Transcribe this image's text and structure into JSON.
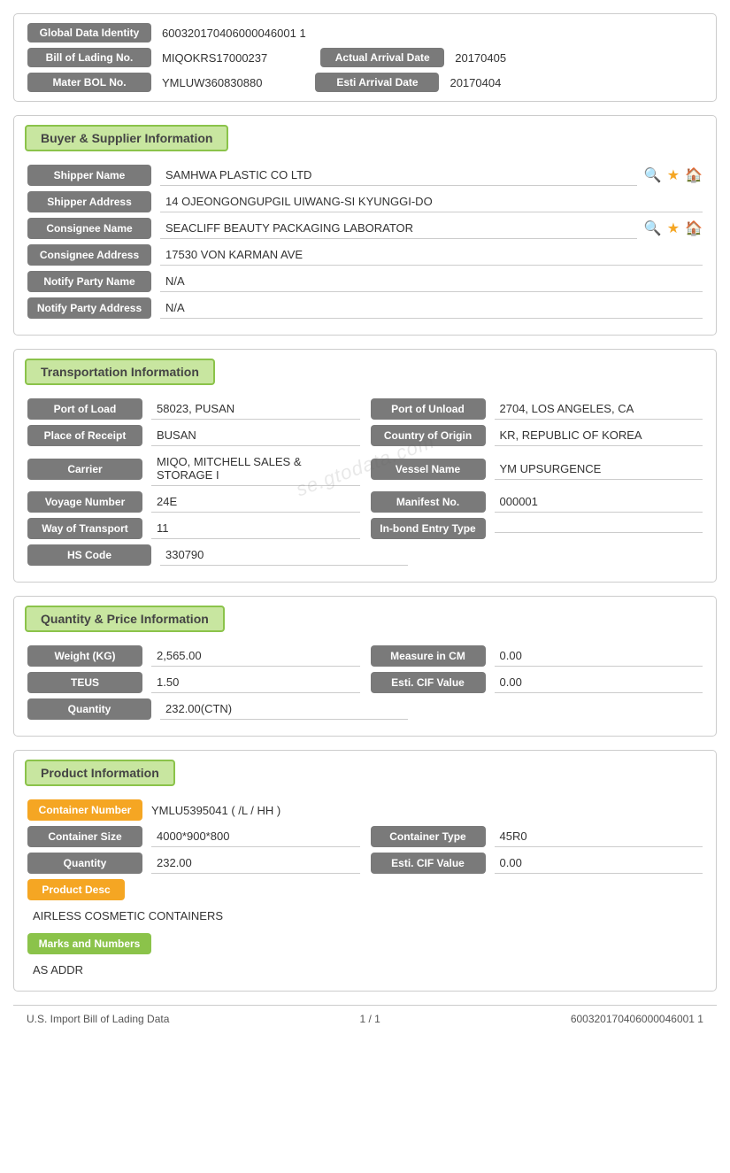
{
  "identity": {
    "global_label": "Global Data Identity",
    "global_value": "600320170406000046001 1",
    "bol_label": "Bill of Lading No.",
    "bol_value": "MIQOKRS17000237",
    "actual_arrival_label": "Actual Arrival Date",
    "actual_arrival_value": "20170405",
    "master_bol_label": "Mater BOL No.",
    "master_bol_value": "YMLUW360830880",
    "esti_arrival_label": "Esti Arrival Date",
    "esti_arrival_value": "20170404"
  },
  "buyer_supplier": {
    "header": "Buyer & Supplier Information",
    "shipper_name_label": "Shipper Name",
    "shipper_name_value": "SAMHWA PLASTIC CO LTD",
    "shipper_address_label": "Shipper Address",
    "shipper_address_value": "14 OJEONGONGUPGIL UIWANG-SI KYUNGGI-DO",
    "consignee_name_label": "Consignee Name",
    "consignee_name_value": "SEACLIFF BEAUTY PACKAGING LABORATOR",
    "consignee_address_label": "Consignee Address",
    "consignee_address_value": "17530 VON KARMAN AVE",
    "notify_party_name_label": "Notify Party Name",
    "notify_party_name_value": "N/A",
    "notify_party_address_label": "Notify Party Address",
    "notify_party_address_value": "N/A"
  },
  "transportation": {
    "header": "Transportation Information",
    "port_load_label": "Port of Load",
    "port_load_value": "58023, PUSAN",
    "port_unload_label": "Port of Unload",
    "port_unload_value": "2704, LOS ANGELES, CA",
    "place_receipt_label": "Place of Receipt",
    "place_receipt_value": "BUSAN",
    "country_origin_label": "Country of Origin",
    "country_origin_value": "KR, REPUBLIC OF KOREA",
    "carrier_label": "Carrier",
    "carrier_value": "MIQO, MITCHELL SALES & STORAGE I",
    "vessel_name_label": "Vessel Name",
    "vessel_name_value": "YM UPSURGENCE",
    "voyage_number_label": "Voyage Number",
    "voyage_number_value": "24E",
    "manifest_no_label": "Manifest No.",
    "manifest_no_value": "000001",
    "way_transport_label": "Way of Transport",
    "way_transport_value": "11",
    "inbond_entry_label": "In-bond Entry Type",
    "inbond_entry_value": "",
    "hs_code_label": "HS Code",
    "hs_code_value": "330790"
  },
  "quantity_price": {
    "header": "Quantity & Price Information",
    "weight_label": "Weight (KG)",
    "weight_value": "2,565.00",
    "measure_label": "Measure in CM",
    "measure_value": "0.00",
    "teus_label": "TEUS",
    "teus_value": "1.50",
    "esti_cif_label": "Esti. CIF Value",
    "esti_cif_value": "0.00",
    "quantity_label": "Quantity",
    "quantity_value": "232.00(CTN)"
  },
  "product_info": {
    "header": "Product Information",
    "container_number_label": "Container Number",
    "container_number_value": "YMLU5395041 ( /L / HH )",
    "container_size_label": "Container Size",
    "container_size_value": "4000*900*800",
    "container_type_label": "Container Type",
    "container_type_value": "45R0",
    "quantity_label": "Quantity",
    "quantity_value": "232.00",
    "esti_cif_label": "Esti. CIF Value",
    "esti_cif_value": "0.00",
    "product_desc_label": "Product Desc",
    "product_desc_value": "AIRLESS COSMETIC CONTAINERS",
    "marks_label": "Marks and Numbers",
    "marks_value": "AS ADDR"
  },
  "footer": {
    "left": "U.S. Import Bill of Lading Data",
    "center": "1 / 1",
    "right": "600320170406000046001 1"
  },
  "watermark": "se.gtodata.com"
}
